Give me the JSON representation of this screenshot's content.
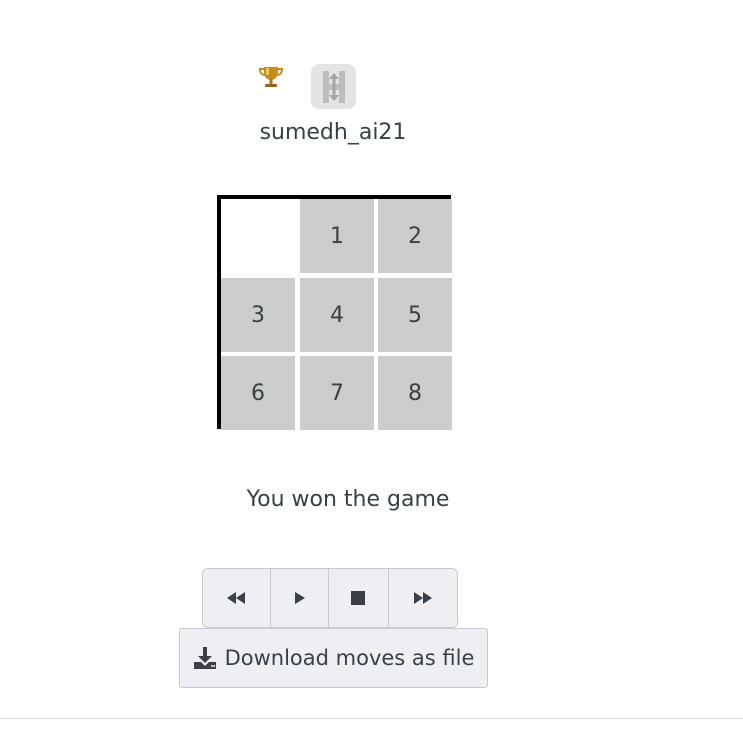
{
  "player": {
    "username": "sumedh_ai21",
    "trophy_icon": "trophy-icon",
    "avatar_icon": "h-arrows-logo-icon"
  },
  "board": {
    "rows": 3,
    "cols": 3,
    "tiles": [
      "",
      "1",
      "2",
      "3",
      "4",
      "5",
      "6",
      "7",
      "8"
    ],
    "tile_color": "#cccccc",
    "border_color": "#000000"
  },
  "status": {
    "message": "You won the game"
  },
  "playback": {
    "buttons": [
      {
        "name": "rewind-button",
        "icon": "rewind-icon"
      },
      {
        "name": "play-button",
        "icon": "play-icon"
      },
      {
        "name": "stop-button",
        "icon": "stop-icon"
      },
      {
        "name": "fast-forward-button",
        "icon": "fast-forward-icon"
      }
    ]
  },
  "download": {
    "label": "Download moves as file",
    "icon": "download-icon"
  }
}
